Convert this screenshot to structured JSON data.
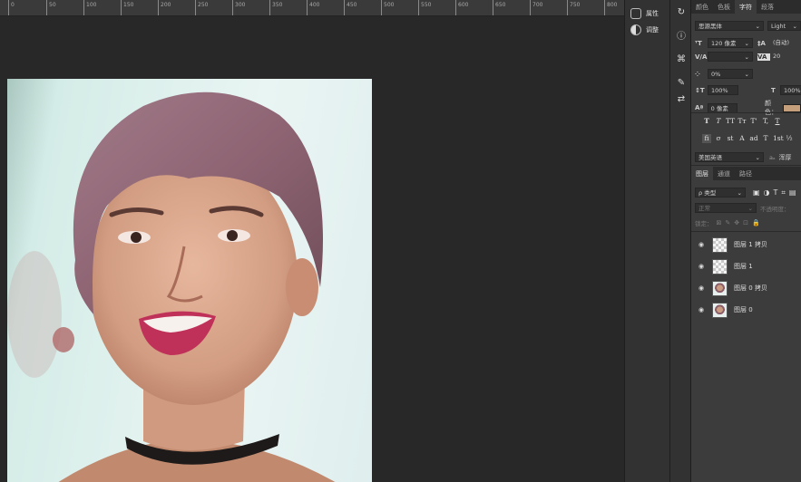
{
  "ruler": {
    "labels": [
      "0",
      "50",
      "100",
      "150",
      "200",
      "250",
      "300",
      "350",
      "400",
      "450",
      "500",
      "550",
      "600",
      "650",
      "700",
      "750",
      "800"
    ]
  },
  "side_panel": {
    "properties_label": "属性",
    "adjust_label": "调整"
  },
  "character_panel": {
    "tabs": [
      "颜色",
      "色板",
      "字符",
      "段落"
    ],
    "active_tab": "字符",
    "font_family": "思源黑体",
    "font_style": "Light",
    "font_size": "120 像素",
    "leading": "(自动)",
    "kerning": "",
    "tracking": "20",
    "scale_percent": "0%",
    "vertical_scale": "100%",
    "horizontal_scale": "100%",
    "baseline_shift": "0 像素",
    "color_label": "颜色：",
    "color_value": "#c59f7b",
    "style_buttons": [
      "T",
      "T",
      "TT",
      "Tт",
      "T'",
      "T,",
      "T"
    ],
    "opentype_buttons": [
      "fi",
      "σ",
      "st",
      "A",
      "ad",
      "T",
      "1st",
      "½"
    ],
    "language": "美国英语",
    "antialias": "浑厚"
  },
  "layers_panel": {
    "tabs": [
      "图层",
      "通道",
      "路径"
    ],
    "active_tab": "图层",
    "filter_kind": "ρ 类型",
    "blend_mode": "正常",
    "opacity_label": "不透明度：",
    "lock_label": "锁定：",
    "layers": [
      {
        "name": "图层 1 拷贝",
        "thumb": "transparent"
      },
      {
        "name": "图层 1",
        "thumb": "transparent"
      },
      {
        "name": "图层 0 拷贝",
        "thumb": "portrait"
      },
      {
        "name": "图层 0",
        "thumb": "portrait"
      }
    ]
  }
}
